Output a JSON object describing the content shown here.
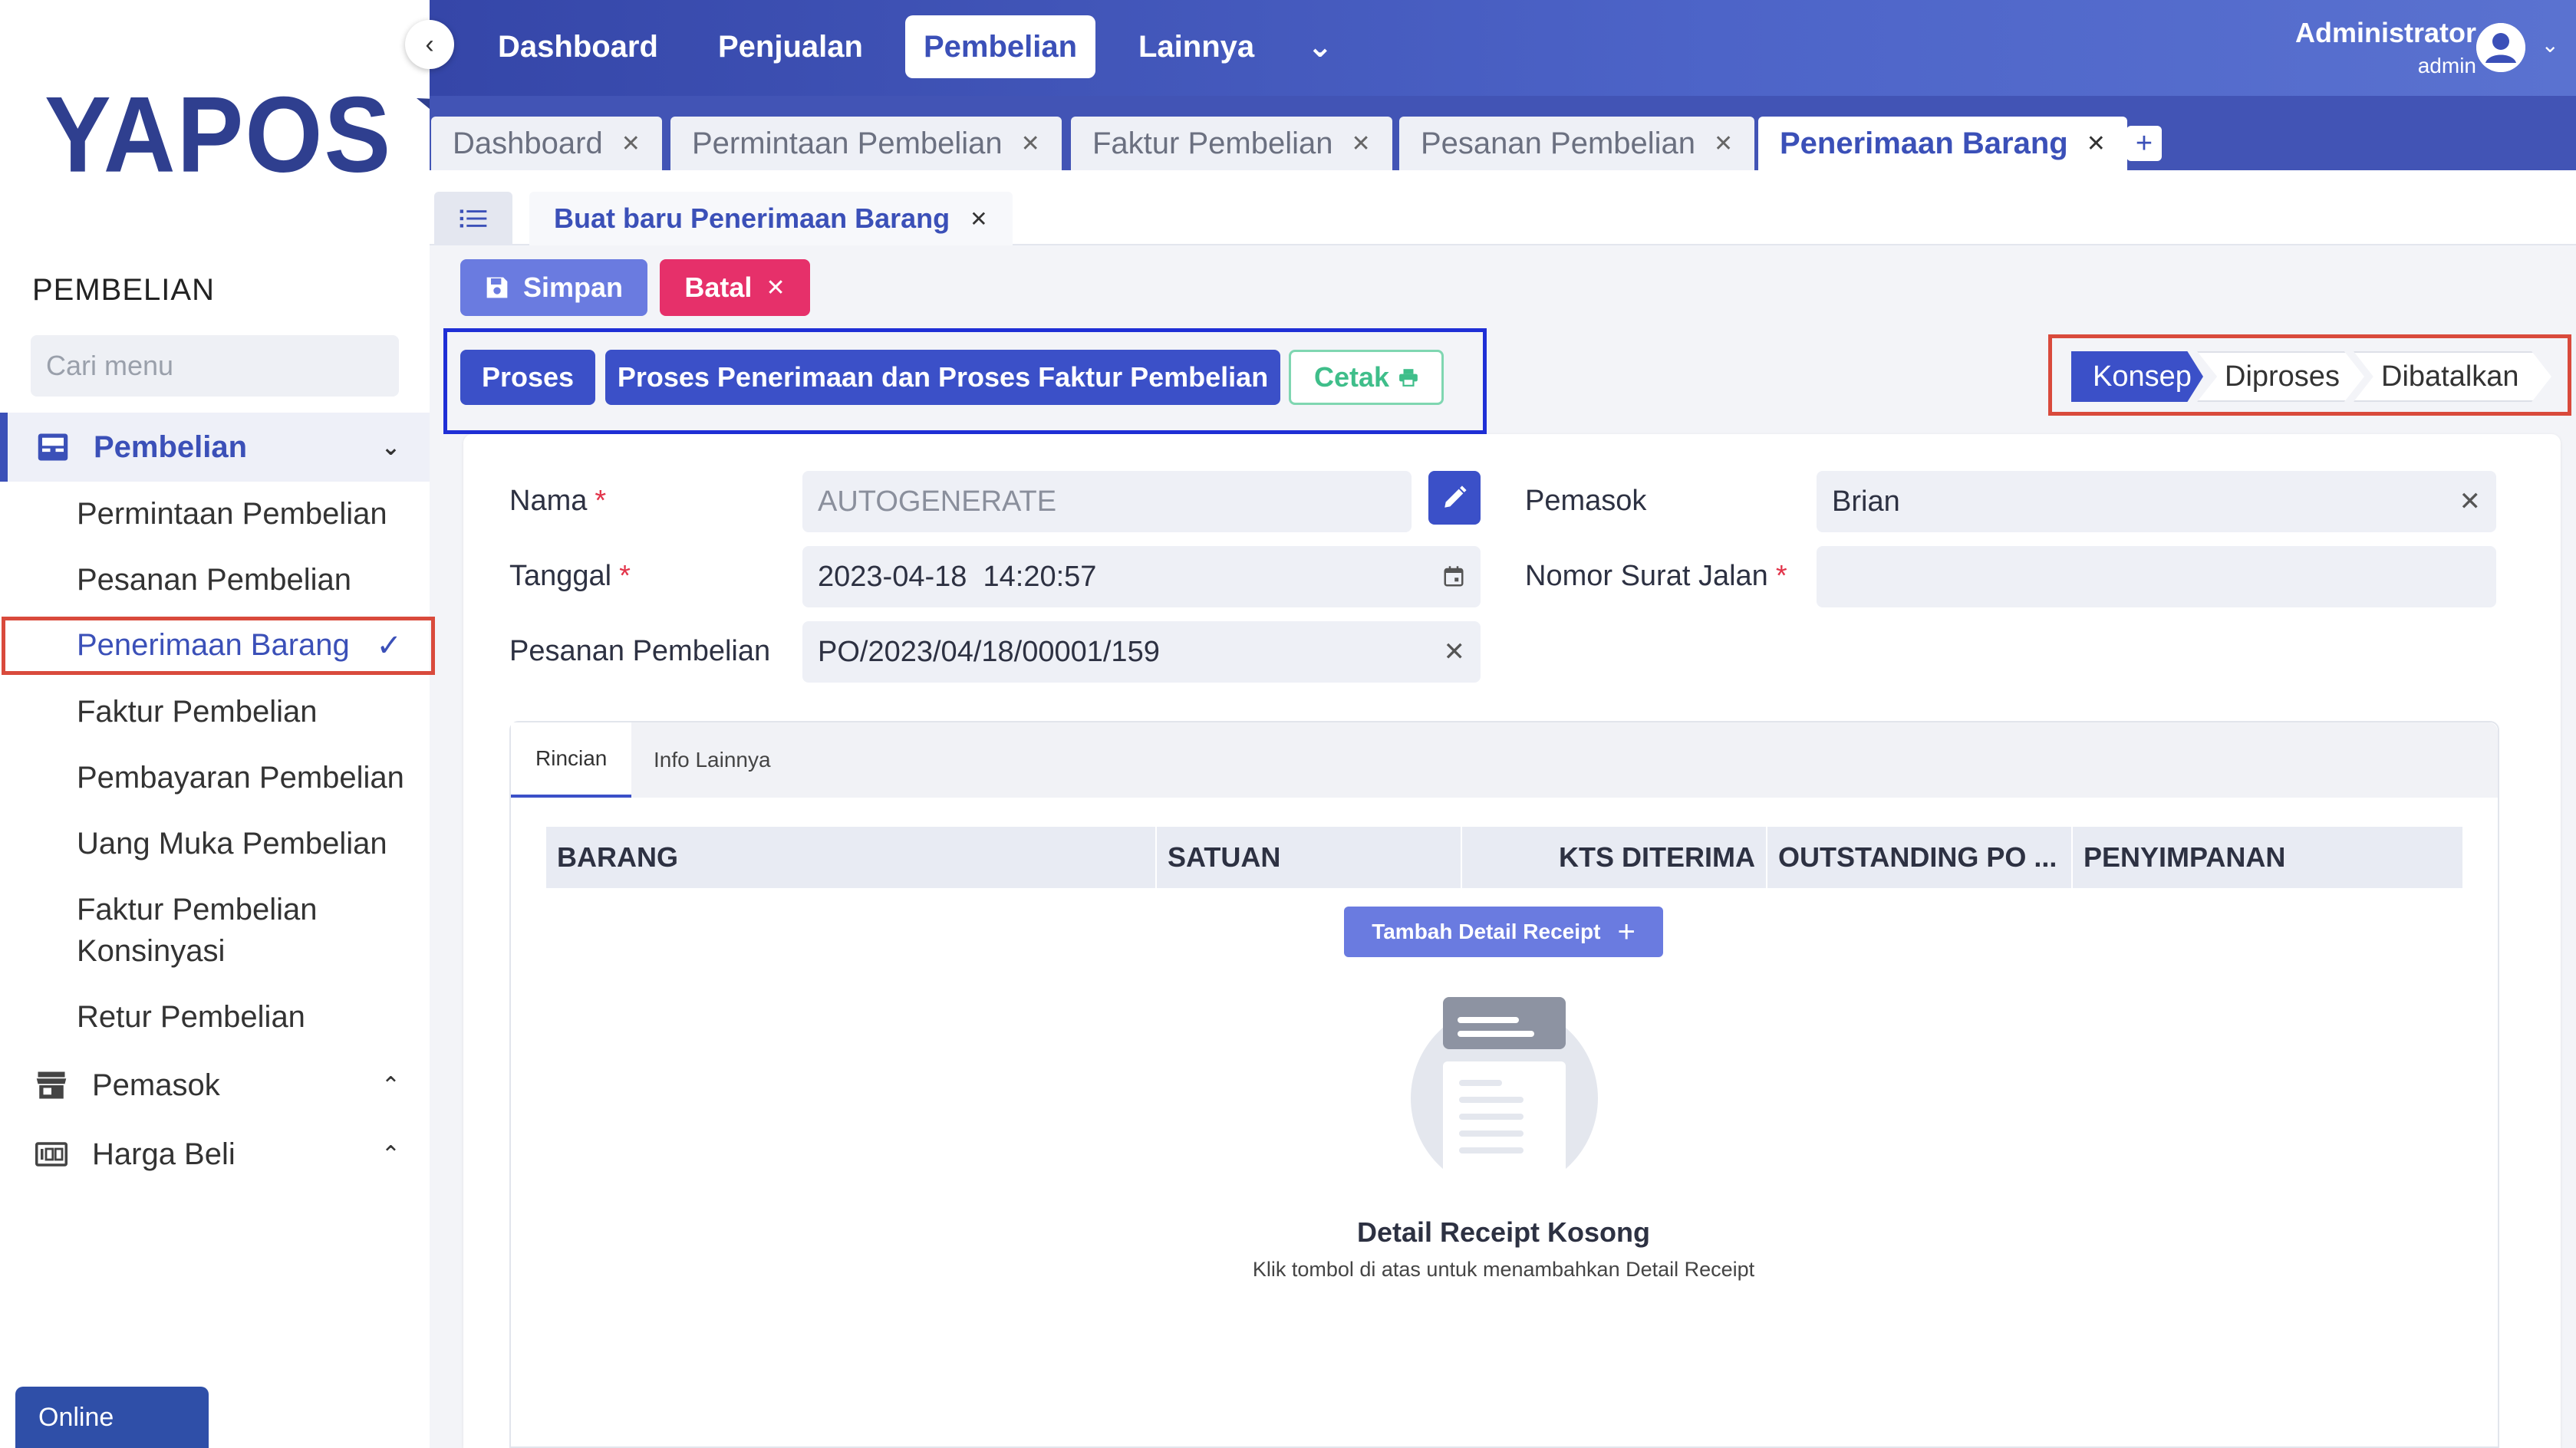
{
  "brand": {
    "logo_text": "YAPOS"
  },
  "sidebar": {
    "section_title": "PEMBELIAN",
    "search_placeholder": "Cari menu",
    "groups": [
      {
        "label": "Pembelian",
        "icon": "inbox-icon",
        "expanded": true
      },
      {
        "label": "Pemasok",
        "icon": "store-icon",
        "expanded": false
      },
      {
        "label": "Harga Beli",
        "icon": "price-icon",
        "expanded": false
      }
    ],
    "sub_items": [
      "Permintaan Pembelian",
      "Pesanan Pembelian",
      "Penerimaan Barang",
      "Faktur Pembelian",
      "Pembayaran Pembelian",
      "Uang Muka Pembelian",
      "Faktur Pembelian Konsinyasi",
      "Retur Pembelian"
    ],
    "sub_item_konsinyasi_line1": "Faktur Pembelian",
    "sub_item_konsinyasi_line2": "Konsinyasi",
    "online_label": "Online"
  },
  "topnav": {
    "items": [
      "Dashboard",
      "Penjualan",
      "Pembelian",
      "Lainnya"
    ],
    "active": "Pembelian",
    "user_name": "Administrator",
    "user_role": "admin"
  },
  "doc_tabs": [
    {
      "label": "Dashboard",
      "active": false
    },
    {
      "label": "Permintaan Pembelian",
      "active": false
    },
    {
      "label": "Faktur Pembelian",
      "active": false
    },
    {
      "label": "Pesanan Pembelian",
      "active": false
    },
    {
      "label": "Penerimaan Barang",
      "active": true
    }
  ],
  "add_tab_label": "+",
  "form_tab": {
    "label": "Buat baru Penerimaan Barang"
  },
  "toolbar": {
    "save_label": "Simpan",
    "cancel_label": "Batal",
    "process_label": "Proses",
    "process_invoice_label": "Proses Penerimaan dan Proses Faktur Pembelian",
    "print_label": "Cetak"
  },
  "status_steps": [
    "Konsep",
    "Diproses",
    "Dibatalkan"
  ],
  "status_active": "Konsep",
  "form": {
    "nama_label": "Nama",
    "nama_value": "AUTOGENERATE",
    "tanggal_label": "Tanggal",
    "tanggal_value": "2023-04-18  14:20:57",
    "pesanan_label": "Pesanan Pembelian",
    "pesanan_value": "PO/2023/04/18/00001/159",
    "pemasok_label": "Pemasok",
    "pemasok_value": "Brian",
    "surat_jalan_label": "Nomor Surat Jalan",
    "surat_jalan_value": "",
    "required_mark": "*"
  },
  "detail": {
    "tabs": [
      "Rincian",
      "Info Lainnya"
    ],
    "columns": [
      "BARANG",
      "SATUAN",
      "KTS DITERIMA",
      "OUTSTANDING PO ...",
      "PENYIMPANAN"
    ],
    "add_label": "Tambah Detail Receipt",
    "empty_title": "Detail Receipt Kosong",
    "empty_subtitle": "Klik tombol di atas untuk menambahkan Detail Receipt"
  },
  "colors": {
    "primary": "#3b50c8",
    "danger": "#e6306a",
    "success": "#3fbe8a",
    "highlight_red": "#d94a3c",
    "highlight_blue": "#1f2fd6"
  }
}
